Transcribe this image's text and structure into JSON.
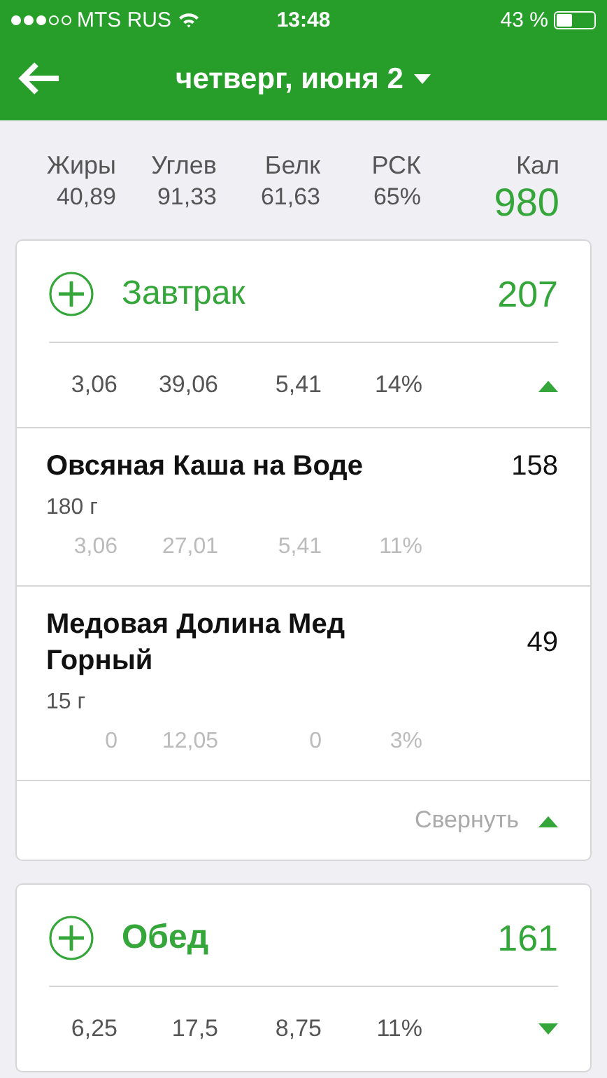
{
  "status_bar": {
    "carrier": "MTS RUS",
    "time": "13:48",
    "battery": "43 %"
  },
  "nav": {
    "title": "четверг, июня 2"
  },
  "summary": {
    "columns": [
      {
        "label": "Жиры",
        "value": "40,89"
      },
      {
        "label": "Углев",
        "value": "91,33"
      },
      {
        "label": "Белк",
        "value": "61,63"
      },
      {
        "label": "РСК",
        "value": "65%"
      }
    ],
    "calories_label": "Кал",
    "calories": "980"
  },
  "meals": [
    {
      "name": "Завтрак",
      "calories": "207",
      "totals": [
        "3,06",
        "39,06",
        "5,41",
        "14%"
      ],
      "expanded": true,
      "collapse_label": "Свернуть",
      "items": [
        {
          "name": "Овсяная Каша на Воде",
          "calories": "158",
          "amount": "180 г",
          "values": [
            "3,06",
            "27,01",
            "5,41",
            "11%"
          ]
        },
        {
          "name": "Медовая Долина Мед Горный",
          "calories": "49",
          "amount": "15 г",
          "values": [
            "0",
            "12,05",
            "0",
            "3%"
          ]
        }
      ]
    },
    {
      "name": "Обед",
      "calories": "161",
      "totals": [
        "6,25",
        "17,5",
        "8,75",
        "11%"
      ],
      "expanded": false
    }
  ]
}
